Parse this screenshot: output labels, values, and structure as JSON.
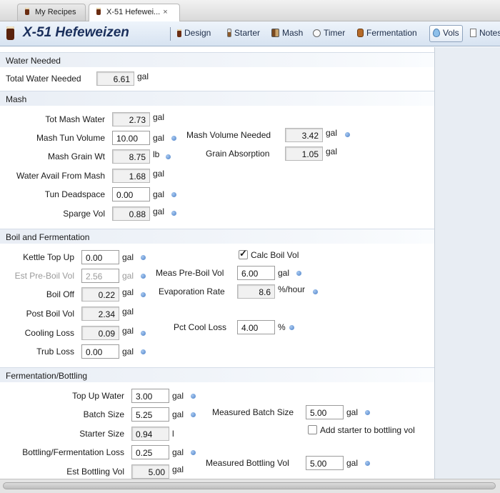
{
  "tabs": [
    {
      "label": "My Recipes",
      "active": false
    },
    {
      "label": "X-51 Hefewei...",
      "active": true,
      "close": "×"
    }
  ],
  "header": {
    "title": "X-51 Hefeweizen",
    "toolbar": [
      {
        "label": "Design",
        "icon": "pint-icon"
      },
      {
        "label": "Starter",
        "icon": "flask-icon"
      },
      {
        "label": "Mash",
        "icon": "mash-tun-icon"
      },
      {
        "label": "Timer",
        "icon": "timer-icon"
      },
      {
        "label": "Fermentation",
        "icon": "fermenter-icon"
      },
      {
        "label": "Vols",
        "icon": "water-drop-icon",
        "active": true
      },
      {
        "label": "Notes",
        "icon": "notes-icon"
      }
    ]
  },
  "water_needed": {
    "section": "Water Needed",
    "total_water_label": "Total Water Needed",
    "total_water_value": "6.61",
    "total_water_unit": "gal"
  },
  "mash": {
    "section": "Mash",
    "tot_mash_water_label": "Tot Mash Water",
    "tot_mash_water_value": "2.73",
    "tot_mash_water_unit": "gal",
    "mash_tun_volume_label": "Mash Tun Volume",
    "mash_tun_volume_value": "10.00",
    "mash_tun_volume_unit": "gal",
    "mash_volume_needed_label": "Mash Volume Needed",
    "mash_volume_needed_value": "3.42",
    "mash_volume_needed_unit": "gal",
    "mash_grain_wt_label": "Mash Grain Wt",
    "mash_grain_wt_value": "8.75",
    "mash_grain_wt_unit": "lb",
    "grain_absorption_label": "Grain Absorption",
    "grain_absorption_value": "1.05",
    "grain_absorption_unit": "gal",
    "water_avail_label": "Water Avail From Mash",
    "water_avail_value": "1.68",
    "water_avail_unit": "gal",
    "tun_deadspace_label": "Tun Deadspace",
    "tun_deadspace_value": "0.00",
    "tun_deadspace_unit": "gal",
    "sparge_vol_label": "Sparge Vol",
    "sparge_vol_value": "0.88",
    "sparge_vol_unit": "gal"
  },
  "boil": {
    "section": "Boil and Fermentation",
    "kettle_top_up_label": "Kettle Top Up",
    "kettle_top_up_value": "0.00",
    "kettle_top_up_unit": "gal",
    "calc_boil_vol_label": "Calc Boil Vol",
    "calc_boil_vol_checked": true,
    "est_pre_boil_label": "Est Pre-Boil Vol",
    "est_pre_boil_value": "2.56",
    "est_pre_boil_unit": "gal",
    "meas_pre_boil_label": "Meas Pre-Boil Vol",
    "meas_pre_boil_value": "6.00",
    "meas_pre_boil_unit": "gal",
    "boil_off_label": "Boil Off",
    "boil_off_value": "0.22",
    "boil_off_unit": "gal",
    "evaporation_rate_label": "Evaporation Rate",
    "evaporation_rate_value": "8.6",
    "evaporation_rate_unit": "%/hour",
    "post_boil_label": "Post Boil Vol",
    "post_boil_value": "2.34",
    "post_boil_unit": "gal",
    "cooling_loss_label": "Cooling Loss",
    "cooling_loss_value": "0.09",
    "cooling_loss_unit": "gal",
    "pct_cool_loss_label": "Pct Cool Loss",
    "pct_cool_loss_value": "4.00",
    "pct_cool_loss_unit": "%",
    "trub_loss_label": "Trub Loss",
    "trub_loss_value": "0.00",
    "trub_loss_unit": "gal"
  },
  "ferm": {
    "section": "Fermentation/Bottling",
    "top_up_water_label": "Top Up Water",
    "top_up_water_value": "3.00",
    "top_up_water_unit": "gal",
    "batch_size_label": "Batch Size",
    "batch_size_value": "5.25",
    "batch_size_unit": "gal",
    "measured_batch_label": "Measured Batch Size",
    "measured_batch_value": "5.00",
    "measured_batch_unit": "gal",
    "starter_size_label": "Starter Size",
    "starter_size_value": "0.94",
    "starter_size_unit": "l",
    "add_starter_label": "Add starter to bottling vol",
    "add_starter_checked": false,
    "bottling_loss_label": "Bottling/Fermentation Loss",
    "bottling_loss_value": "0.25",
    "bottling_loss_unit": "gal",
    "est_bottling_label": "Est Bottling Vol",
    "est_bottling_value": "5.00",
    "est_bottling_unit": "gal",
    "measured_bottling_label": "Measured Bottling Vol",
    "measured_bottling_value": "5.00",
    "measured_bottling_unit": "gal"
  },
  "colors": {
    "accent": "#4a80c8",
    "header_title": "#1a2f5c",
    "section_bg": "#e9eef5"
  }
}
